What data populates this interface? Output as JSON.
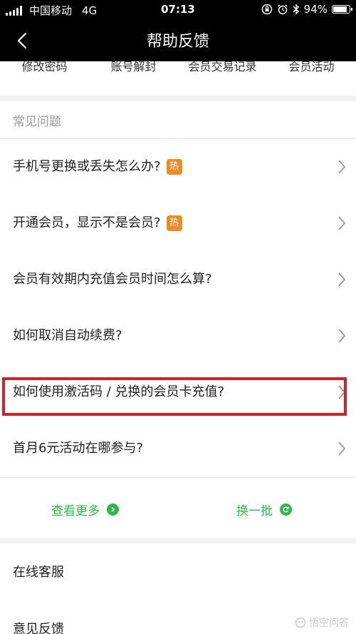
{
  "status_bar": {
    "carrier": "中国移动",
    "network": "4G",
    "time": "07:13",
    "battery": "94%",
    "battery_level": 0.94
  },
  "nav": {
    "title": "帮助反馈"
  },
  "quick_links": [
    "修改密码",
    "账号解封",
    "会员交易记录",
    "会员活动"
  ],
  "faq": {
    "header": "常见问题",
    "items": [
      {
        "text": "手机号更换或丢失怎么办?",
        "badge": "热"
      },
      {
        "text": "开通会员，显示不是会员?",
        "badge": "热"
      },
      {
        "text": "会员有效期内充值会员时间怎么算?"
      },
      {
        "text": "如何取消自动续费?"
      },
      {
        "text": "如何使用激活码 / 兑换的会员卡充值?"
      },
      {
        "text": "首月6元活动在哪参与?"
      }
    ]
  },
  "actions": {
    "more": "查看更多",
    "refresh": "换一批"
  },
  "menu": {
    "online_service": "在线客服",
    "feedback": "意见反馈"
  },
  "watermark": "悟空问答",
  "colors": {
    "accent_green": "#2db84a",
    "hot_badge": "#f08a24",
    "highlight_red": "#d0202a"
  }
}
